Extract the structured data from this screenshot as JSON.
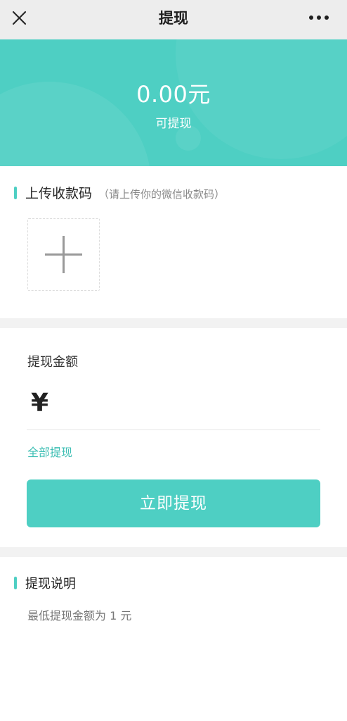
{
  "nav": {
    "title": "提现",
    "close_icon": "close-icon",
    "more_icon": "more-dots-icon"
  },
  "balance": {
    "amount": "0.00元",
    "label": "可提现"
  },
  "upload": {
    "title": "上传收款码",
    "hint": "（请上传你的微信收款码）",
    "add_icon": "plus-icon"
  },
  "withdraw": {
    "field_label": "提现金额",
    "currency_symbol": "¥",
    "amount_value": "",
    "withdraw_all_label": "全部提现",
    "submit_label": "立即提现"
  },
  "notes": {
    "title": "提现说明",
    "text": "最低提现金额为 1 元"
  },
  "colors": {
    "accent": "#4ecfc3",
    "nav_bg": "#ededed",
    "section_gap": "#f2f2f2",
    "link": "#3fbfb4"
  }
}
